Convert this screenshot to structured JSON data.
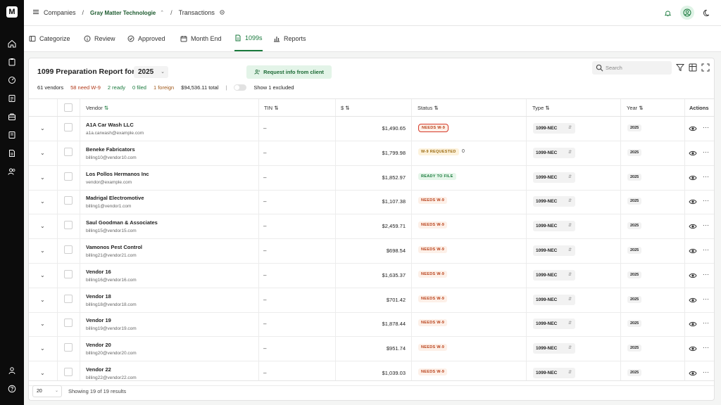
{
  "breadcrumb": {
    "companies": "Companies",
    "company": "Gray Matter Technologie",
    "current": "Transactions"
  },
  "logo_text": "M",
  "tabs": [
    {
      "label": "Categorize",
      "icon": "categorize-icon"
    },
    {
      "label": "Review",
      "icon": "info-icon"
    },
    {
      "label": "Approved",
      "icon": "check-circle-icon"
    },
    {
      "label": "Month End",
      "icon": "calendar-icon"
    },
    {
      "label": "1099s",
      "icon": "document-icon",
      "active": true
    },
    {
      "label": "Reports",
      "icon": "bar-chart-icon"
    }
  ],
  "report": {
    "title": "1099 Preparation Report for",
    "year": "2025",
    "request_button": "Request info from client",
    "search_placeholder": "Search"
  },
  "stats": {
    "vendors": "61 vendors",
    "needs_w9": "58 need W-9",
    "ready": "2 ready",
    "filed": "0 filed",
    "foreign": "1 foreign",
    "total": "$94,536.11 total",
    "divider": "|",
    "excluded": "Show 1 excluded"
  },
  "columns": {
    "vendor": "Vendor",
    "tin": "TIN",
    "amount": "$",
    "status": "Status",
    "type": "Type",
    "year": "Year",
    "actions": "Actions"
  },
  "rows": [
    {
      "name": "A1A Car Wash LLC",
      "email": "a1a.carwash@example.com",
      "tin": "–",
      "amount": "$1,490.65",
      "status": "NEEDS W-9",
      "kind": "needs",
      "highlight": true,
      "count": "",
      "type": "1099-NEC",
      "year": "2025"
    },
    {
      "name": "Beneke Fabricators",
      "email": "billing10@vendor10.com",
      "tin": "–",
      "amount": "$1,799.98",
      "status": "W-9 REQUESTED",
      "kind": "req",
      "count": "0",
      "type": "1099-NEC",
      "year": "2025"
    },
    {
      "name": "Los Pollos Hermanos Inc",
      "email": "vendor@example.com",
      "tin": "–",
      "amount": "$1,852.97",
      "status": "READY TO FILE",
      "kind": "ready",
      "count": "",
      "type": "1099-NEC",
      "year": "2025"
    },
    {
      "name": "Madrigal Electromotive",
      "email": "billing1@vendor1.com",
      "tin": "–",
      "amount": "$1,107.38",
      "status": "NEEDS W-9",
      "kind": "needs",
      "count": "",
      "type": "1099-NEC",
      "year": "2025"
    },
    {
      "name": "Saul Goodman & Associates",
      "email": "billing15@vendor15.com",
      "tin": "–",
      "amount": "$2,459.71",
      "status": "NEEDS W-9",
      "kind": "needs",
      "count": "",
      "type": "1099-NEC",
      "year": "2025"
    },
    {
      "name": "Vamonos Pest Control",
      "email": "billing21@vendor21.com",
      "tin": "–",
      "amount": "$698.54",
      "status": "NEEDS W-9",
      "kind": "needs",
      "count": "",
      "type": "1099-NEC",
      "year": "2025"
    },
    {
      "name": "Vendor 16",
      "email": "billing16@vendor16.com",
      "tin": "–",
      "amount": "$1,635.37",
      "status": "NEEDS W-9",
      "kind": "needs",
      "count": "",
      "type": "1099-NEC",
      "year": "2025"
    },
    {
      "name": "Vendor 18",
      "email": "billing18@vendor18.com",
      "tin": "–",
      "amount": "$701.42",
      "status": "NEEDS W-9",
      "kind": "needs",
      "count": "",
      "type": "1099-NEC",
      "year": "2025"
    },
    {
      "name": "Vendor 19",
      "email": "billing19@vendor19.com",
      "tin": "–",
      "amount": "$1,878.44",
      "status": "NEEDS W-9",
      "kind": "needs",
      "count": "",
      "type": "1099-NEC",
      "year": "2025"
    },
    {
      "name": "Vendor 20",
      "email": "billing20@vendor20.com",
      "tin": "–",
      "amount": "$951.74",
      "status": "NEEDS W-9",
      "kind": "needs",
      "count": "",
      "type": "1099-NEC",
      "year": "2025"
    },
    {
      "name": "Vendor 22",
      "email": "billing22@vendor22.com",
      "tin": "–",
      "amount": "$1,039.03",
      "status": "NEEDS W-9",
      "kind": "needs",
      "count": "",
      "type": "1099-NEC",
      "year": "2025"
    }
  ],
  "footer": {
    "page_size": "20",
    "results": "Showing 19 of 19 results"
  },
  "colors": {
    "accent_green": "#1a7a3d",
    "needs_red": "#b8401a",
    "sidebar_bg": "#0c0c0c"
  }
}
